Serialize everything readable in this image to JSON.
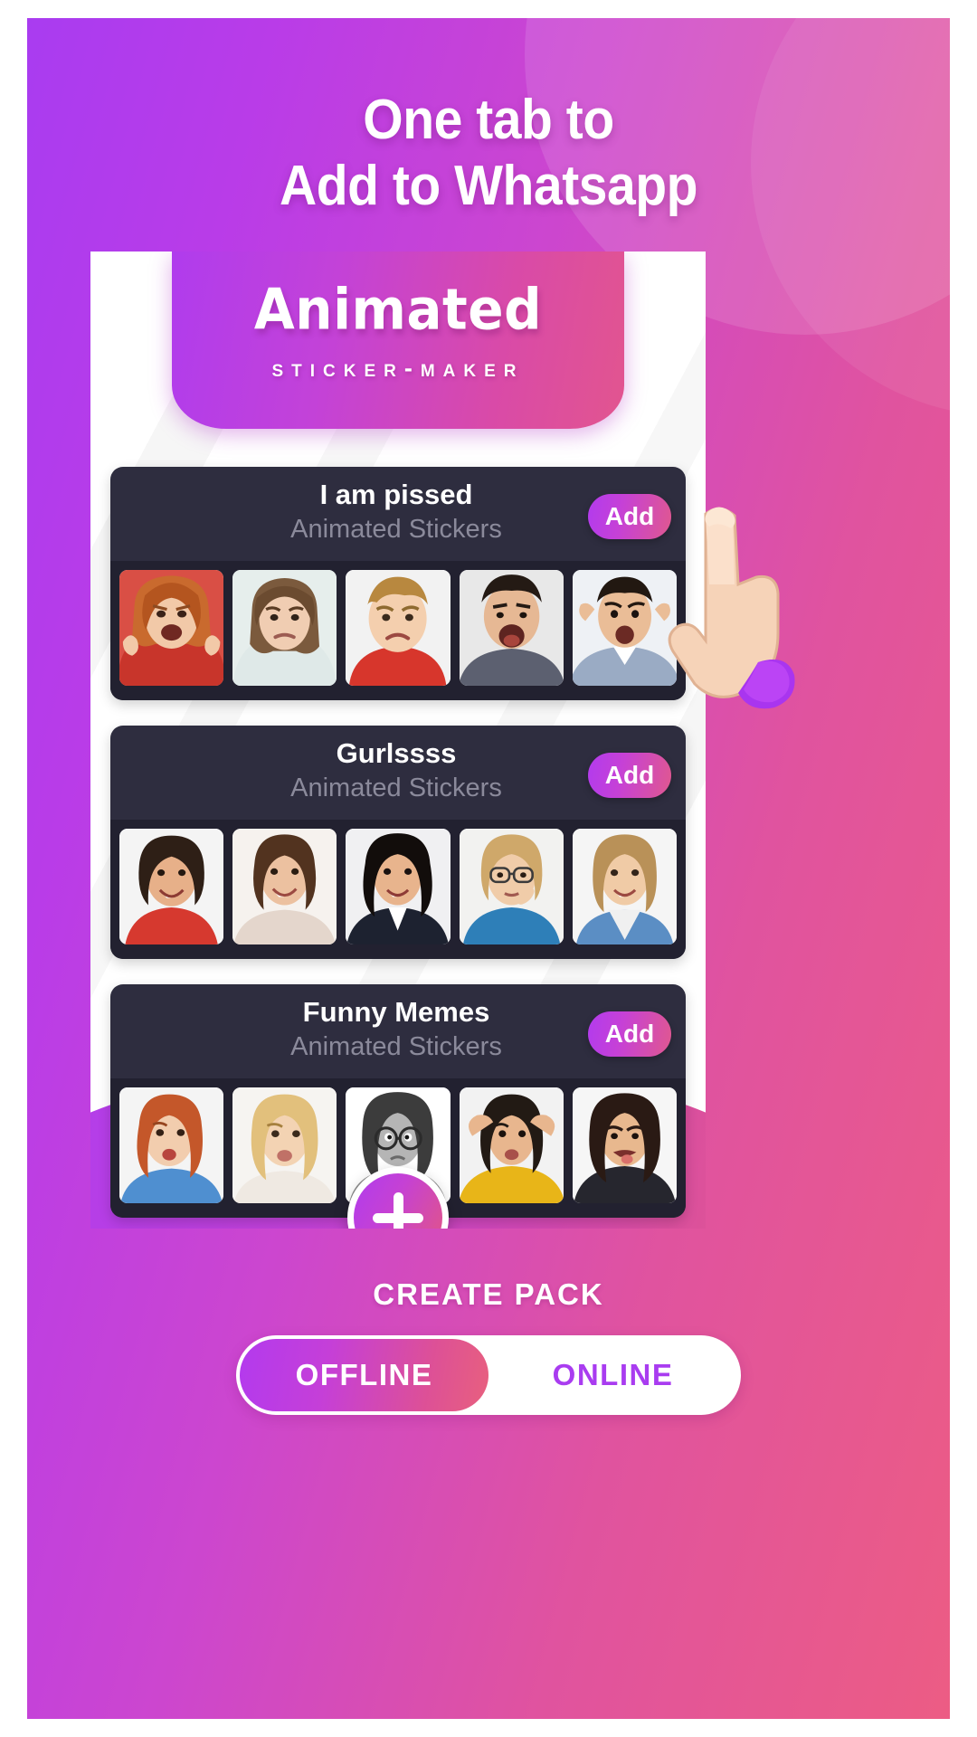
{
  "headline": {
    "line1": "One tab to",
    "line2": "Add to Whatsapp"
  },
  "logo": {
    "main": "Animated",
    "sub": "Sticker-Maker"
  },
  "packs": [
    {
      "title": "I am pissed",
      "subtitle": "Animated Stickers",
      "add_label": "Add",
      "thumbs": [
        "angry-redhead-woman",
        "frowning-girl",
        "angry-boy-red-shirt",
        "screaming-man",
        "frustrated-man-hands-head"
      ]
    },
    {
      "title": "Gurlssss",
      "subtitle": "Animated Stickers",
      "add_label": "Add",
      "thumbs": [
        "smiling-curly-woman-red",
        "laughing-brunette",
        "confident-woman-dark-hair",
        "thinking-woman-glasses",
        "smiling-woman-denim"
      ]
    },
    {
      "title": "Funny Memes",
      "subtitle": "Animated Stickers",
      "add_label": "Add",
      "thumbs": [
        "redhead-duckface",
        "blonde-duckface",
        "bw-girl-glasses",
        "yellow-shirt-woman",
        "tongue-out-woman"
      ]
    }
  ],
  "fab": {
    "icon": "plus-icon",
    "label": "CREATE PACK"
  },
  "toggle": {
    "options": [
      {
        "label": "OFFLINE",
        "active": true
      },
      {
        "label": "ONLINE",
        "active": false
      }
    ]
  },
  "colors": {
    "bg_gradient_start": "#a93cf0",
    "bg_gradient_end": "#ec5c84",
    "card_bg": "#2e2d3f",
    "card_strip_bg": "#222130",
    "card_subtitle": "#8b8a9b",
    "accent_purple": "#b23bee",
    "accent_pink": "#e0588f",
    "white": "#ffffff"
  }
}
